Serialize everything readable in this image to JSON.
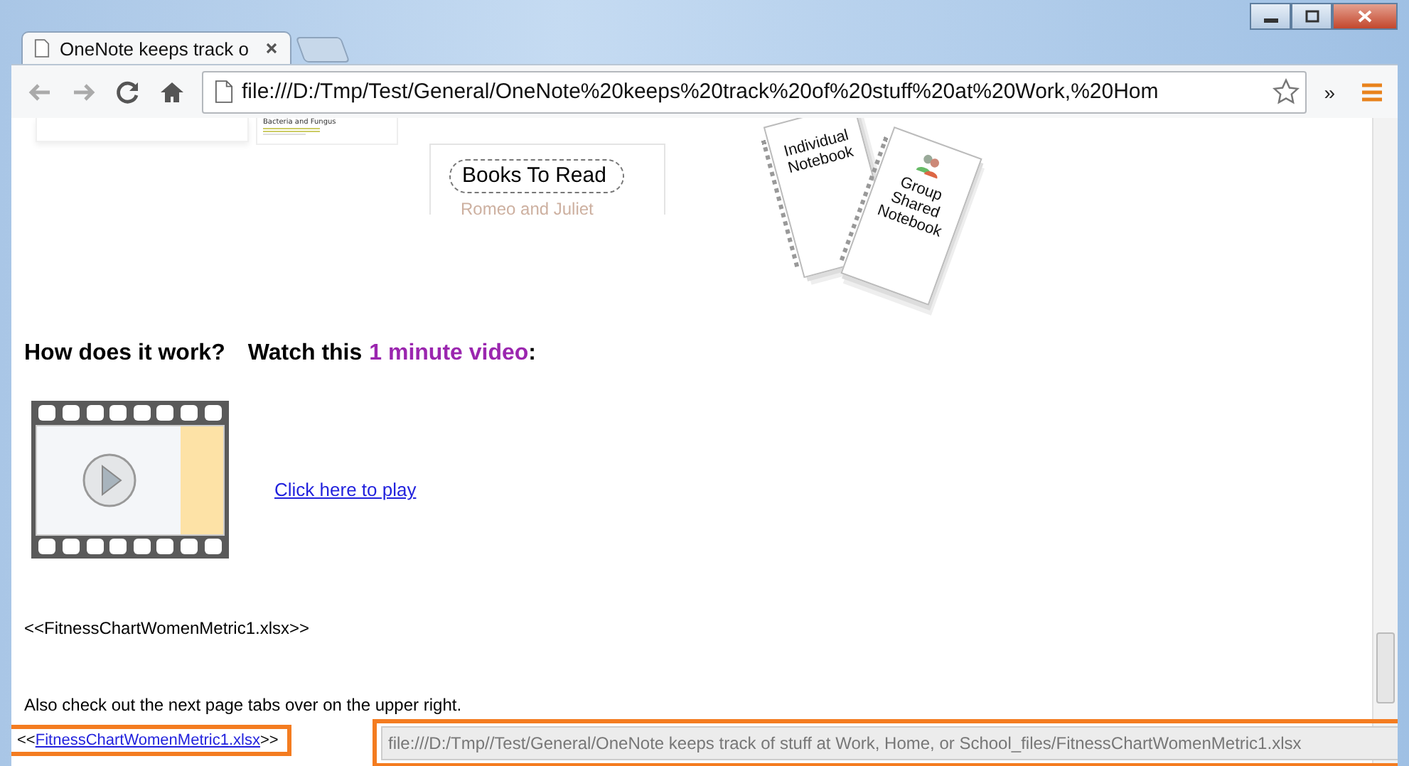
{
  "window": {
    "controls": [
      {
        "kind": "minimize"
      },
      {
        "kind": "maximize"
      },
      {
        "kind": "close"
      }
    ]
  },
  "tabs": [
    {
      "title": "OneNote keeps track o",
      "selected": true
    }
  ],
  "toolbar": {
    "address": "file:///D:/Tmp/Test/General/OneNote%20keeps%20track%20of%20stuff%20at%20Work,%20Hom",
    "overflow": "»"
  },
  "illustrations": {
    "thumbnail_caption": "Bacteria and Fungus",
    "books_title": "Books To Read",
    "books_item": "Romeo and Juliet",
    "notebooks": [
      "Individual Notebook",
      "Group Shared Notebook"
    ]
  },
  "heading": {
    "question": "How does it work?",
    "lead": "Watch this",
    "link": "1 minute video",
    "tail": ":"
  },
  "video": {
    "play_link": "Click here to play"
  },
  "attachment": "<<FitnessChartWomenMetric1.xlsx>>",
  "note": "Also check out the next page tabs over on the upper right.",
  "highlight_link": {
    "before": "<<",
    "link": "FitnessChartWomenMetric1.xlsx",
    "after": ">>"
  },
  "status_url": "file:///D:/Tmp//Test/General/OneNote keeps track of stuff at Work, Home, or School_files/FitnessChartWomenMetric1.xlsx"
}
